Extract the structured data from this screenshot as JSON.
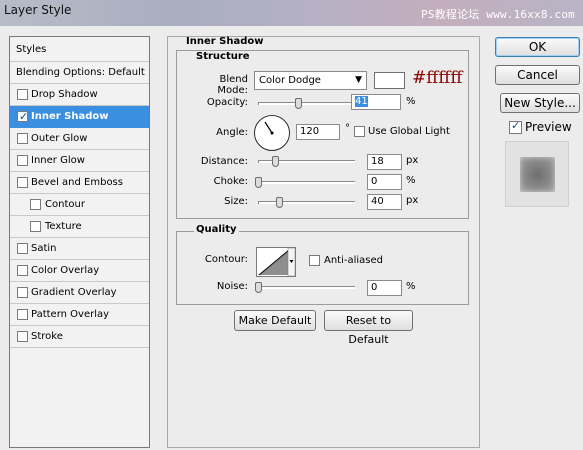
{
  "window": {
    "title": "Layer Style",
    "watermark": "PS教程论坛 www.16xx8.com"
  },
  "styles_list": {
    "header": "Styles",
    "blending_options": "Blending Options: Default",
    "items": [
      {
        "label": "Drop Shadow",
        "checked": false,
        "indent": false
      },
      {
        "label": "Inner Shadow",
        "checked": true,
        "indent": false,
        "selected": true
      },
      {
        "label": "Outer Glow",
        "checked": false,
        "indent": false
      },
      {
        "label": "Inner Glow",
        "checked": false,
        "indent": false
      },
      {
        "label": "Bevel and Emboss",
        "checked": false,
        "indent": false
      },
      {
        "label": "Contour",
        "checked": false,
        "indent": true
      },
      {
        "label": "Texture",
        "checked": false,
        "indent": true
      },
      {
        "label": "Satin",
        "checked": false,
        "indent": false
      },
      {
        "label": "Color Overlay",
        "checked": false,
        "indent": false
      },
      {
        "label": "Gradient Overlay",
        "checked": false,
        "indent": false
      },
      {
        "label": "Pattern Overlay",
        "checked": false,
        "indent": false
      },
      {
        "label": "Stroke",
        "checked": false,
        "indent": false
      }
    ]
  },
  "panel": {
    "title": "Inner Shadow",
    "structure": {
      "title": "Structure",
      "blend_mode_label": "Blend Mode:",
      "blend_mode_value": "Color Dodge",
      "color_hex_annotation": "#ffffff",
      "opacity_label": "Opacity:",
      "opacity_value": "41",
      "opacity_unit": "%",
      "angle_label": "Angle:",
      "angle_value": "120",
      "angle_unit": "°",
      "global_light_label": "Use Global Light",
      "distance_label": "Distance:",
      "distance_value": "18",
      "distance_unit": "px",
      "choke_label": "Choke:",
      "choke_value": "0",
      "choke_unit": "%",
      "size_label": "Size:",
      "size_value": "40",
      "size_unit": "px"
    },
    "quality": {
      "title": "Quality",
      "contour_label": "Contour:",
      "anti_aliased_label": "Anti-aliased",
      "noise_label": "Noise:",
      "noise_value": "0",
      "noise_unit": "%"
    },
    "make_default_label": "Make Default",
    "reset_default_label": "Reset to Default"
  },
  "buttons": {
    "ok": "OK",
    "cancel": "Cancel",
    "new_style": "New Style...",
    "preview_label": "Preview"
  },
  "colors": {
    "selection": "#3a8fe0",
    "annotation": "#8b0000",
    "shadow_color": "#ffffff"
  }
}
